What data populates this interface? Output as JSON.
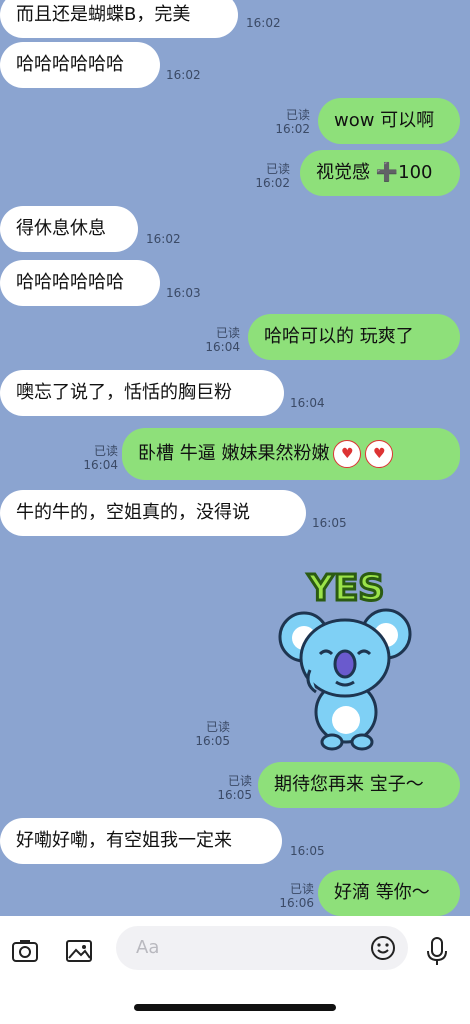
{
  "colors": {
    "background": "#8ba4d0",
    "outgoing": "#8ee07a",
    "incoming": "#ffffff"
  },
  "messages": [
    {
      "dir": "in",
      "text": "而且还是蝴蝶B，完美",
      "time": "16:02"
    },
    {
      "dir": "in",
      "text": "哈哈哈哈哈哈",
      "time": "16:02"
    },
    {
      "dir": "out",
      "text": "wow 可以啊",
      "time": "16:02",
      "read": "已读"
    },
    {
      "dir": "out",
      "text": "视觉感 ➕100",
      "time": "16:02",
      "read": "已读"
    },
    {
      "dir": "in",
      "text": "得休息休息",
      "time": "16:02"
    },
    {
      "dir": "in",
      "text": "哈哈哈哈哈哈",
      "time": "16:03"
    },
    {
      "dir": "out",
      "text": "哈哈可以的 玩爽了",
      "time": "16:04",
      "read": "已读"
    },
    {
      "dir": "in",
      "text": "噢忘了说了，恬恬的胸巨粉",
      "time": "16:04"
    },
    {
      "dir": "out",
      "text": "卧槽  牛逼  嫩妹果然粉嫩",
      "time": "16:04",
      "read": "已读",
      "emoji": [
        "heart-eyes-emoji",
        "heart-eyes-emoji"
      ]
    },
    {
      "dir": "in",
      "text": "牛的牛的，空姐真的，没得说",
      "time": "16:05"
    },
    {
      "dir": "out",
      "sticker": true,
      "sticker_text": "YES",
      "time": "16:05",
      "read": "已读"
    },
    {
      "dir": "out",
      "text": "期待您再来 宝子～",
      "time": "16:05",
      "read": "已读"
    },
    {
      "dir": "in",
      "text": "好嘞好嘞，有空姐我一定来",
      "time": "16:05"
    },
    {
      "dir": "out",
      "text": "好滴 等你～",
      "time": "16:06",
      "read": "已读"
    }
  ],
  "composer": {
    "placeholder": "Aa"
  }
}
